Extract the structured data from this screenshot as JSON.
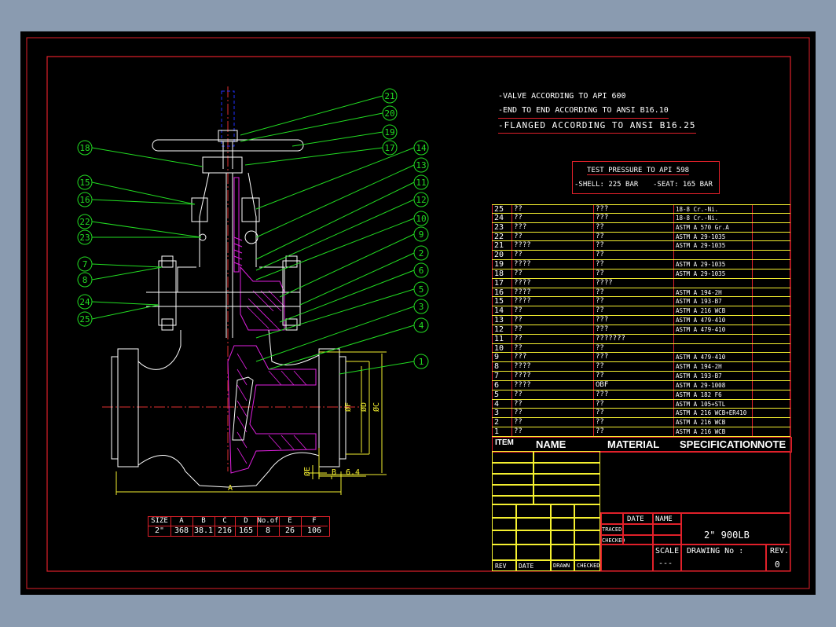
{
  "colors": {
    "border": "#e0202a",
    "text": "#ffffff",
    "callout": "#22dd22",
    "dim": "#f5f030",
    "hatch": "#e020e0",
    "axis": "#e03030",
    "stem": "#2030ff",
    "background": "#000000",
    "window": "#8a9bb0"
  },
  "notes": [
    "-VALVE ACCORDING TO API 600",
    "-END TO END ACCORDING TO ANSI B16.10",
    "-FLANGED ACCORDING TO ANSI B16.25"
  ],
  "test_pressure": {
    "title": "TEST PRESSURE TO API 598",
    "shell": "-SHELL: 225 BAR",
    "seat": "-SEAT: 165 BAR"
  },
  "callouts_left": [
    "18",
    "15",
    "16",
    "22",
    "23",
    "7",
    "8",
    "24",
    "25"
  ],
  "callouts_right": [
    "21",
    "20",
    "19",
    "17",
    "14",
    "13",
    "11",
    "12",
    "10",
    "9",
    "2",
    "6",
    "5",
    "3",
    "4",
    "1"
  ],
  "dims": {
    "A": "A",
    "B": "B",
    "six_four": "6.4",
    "phiE": "ØE",
    "phiF": "ØF",
    "phiD": "ØD",
    "phiC": "ØC"
  },
  "size_table": {
    "headers": [
      "SIZE",
      "A",
      "B",
      "C",
      "D",
      "No.of",
      "E",
      "F"
    ],
    "values": [
      "2\"",
      "368",
      "38.1",
      "216",
      "165",
      "8",
      "26",
      "106"
    ]
  },
  "parts": [
    {
      "no": "25",
      "name": "??",
      "material": "???",
      "spec": "18-8 Cr.-Ni."
    },
    {
      "no": "24",
      "name": "??",
      "material": "???",
      "spec": "18-8 Cr.-Ni."
    },
    {
      "no": "23",
      "name": "???",
      "material": "??",
      "spec": "ASTM A 570 Gr.A"
    },
    {
      "no": "22",
      "name": "??",
      "material": "??",
      "spec": "ASTM A 29-1035"
    },
    {
      "no": "21",
      "name": "????",
      "material": "??",
      "spec": "ASTM A 29-1035"
    },
    {
      "no": "20",
      "name": "??",
      "material": "??",
      "spec": ""
    },
    {
      "no": "19",
      "name": "????",
      "material": "??",
      "spec": "ASTM A 29-1035"
    },
    {
      "no": "18",
      "name": "??",
      "material": "??",
      "spec": "ASTM A 29-1035"
    },
    {
      "no": "17",
      "name": "????",
      "material": "????",
      "spec": ""
    },
    {
      "no": "16",
      "name": "????",
      "material": "??",
      "spec": "ASTM A 194-2H"
    },
    {
      "no": "15",
      "name": "????",
      "material": "??",
      "spec": "ASTM A 193-B7"
    },
    {
      "no": "14",
      "name": "??",
      "material": "??",
      "spec": "ASTM A 216 WCB"
    },
    {
      "no": "13",
      "name": "??",
      "material": "???",
      "spec": "ASTM A 479-410"
    },
    {
      "no": "12",
      "name": "??",
      "material": "???",
      "spec": "ASTM A 479-410"
    },
    {
      "no": "11",
      "name": "??",
      "material": "???????",
      "spec": ""
    },
    {
      "no": "10",
      "name": "??",
      "material": "??",
      "spec": ""
    },
    {
      "no": "9",
      "name": "???",
      "material": "???",
      "spec": "ASTM A 479-410"
    },
    {
      "no": "8",
      "name": "????",
      "material": "??",
      "spec": "ASTM A 194-2H"
    },
    {
      "no": "7",
      "name": "????",
      "material": "??",
      "spec": "ASTM A 193-B7"
    },
    {
      "no": "6",
      "name": "????",
      "material": "OBF",
      "spec": "ASTM A 29-1008"
    },
    {
      "no": "5",
      "name": "??",
      "material": "???",
      "spec": "ASTM A 182 F6"
    },
    {
      "no": "4",
      "name": "??",
      "material": "??",
      "spec": "ASTM A 105+STL"
    },
    {
      "no": "3",
      "name": "??",
      "material": "??",
      "spec": "ASTM A 216 WCB+ER410"
    },
    {
      "no": "2",
      "name": "??",
      "material": "??",
      "spec": "ASTM A 216 WCB"
    },
    {
      "no": "1",
      "name": "??",
      "material": "??",
      "spec": "ASTM A 216 WCB"
    }
  ],
  "parts_header": {
    "item": "ITEM",
    "name": "NAME",
    "material": "MATERIAL",
    "spec": "SPECIFICATION",
    "note": "NOTE"
  },
  "title_block": {
    "date": "DATE",
    "name": "NAME",
    "traced": "TRACED",
    "checked": "CHECKED",
    "title": "2\" 900LB",
    "scale_label": "SCALE",
    "scale": "---",
    "drawing_no": "DRAWING No :",
    "rev_label": "REV.",
    "rev": "0",
    "rev_col": "REV",
    "date_col": "DATE",
    "drawn_col": "DRAWN",
    "checked_col": "CHECKED"
  }
}
